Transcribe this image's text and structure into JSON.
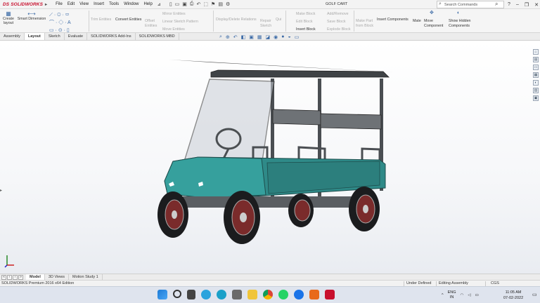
{
  "app": {
    "logo_ds": "DS",
    "logo_text": "SOLIDWORKS",
    "document_title": "GOLF CART",
    "menu": [
      "File",
      "Edit",
      "View",
      "Insert",
      "Tools",
      "Window",
      "Help"
    ],
    "search_placeholder": "Search Commands"
  },
  "commands": {
    "create_layout": "Create layout",
    "smart_dimension": "Smart Dimension",
    "trim_entities": "Trim Entities",
    "convert_entities": "Convert Entities",
    "offset_entities": "Offset Entities",
    "mirror_entities": "Mirror Entities",
    "linear_sketch_pattern": "Linear Sketch Pattern",
    "move_entities": "Move Entities",
    "display_delete_relations": "Display/Delete Relations",
    "repair_sketch": "Repair Sketch",
    "quick": "Qui",
    "make_block": "Make Block",
    "edit_block": "Edit Block",
    "insert_block": "Insert Block",
    "add_remove": "Add/Remove",
    "save_block": "Save Block",
    "explode_block": "Explode Block",
    "make_part_from_block": "Make Part from Block",
    "insert_components": "Insert Components",
    "mate": "Mate",
    "move_component": "Move Component",
    "show_hidden_components": "Show Hidden Components"
  },
  "tabs": [
    "Assembly",
    "Layout",
    "Sketch",
    "Evaluate",
    "SOLIDWORKS Add-Ins",
    "SOLIDWORKS MBD"
  ],
  "active_tab": "Layout",
  "model_tabs": [
    "Model",
    "3D Views",
    "Motion Study 1"
  ],
  "active_model_tab": "Model",
  "status": {
    "product": "SOLIDWORKS Premium 2016 x64 Edition",
    "definition": "Under Defined",
    "mode": "Editing Assembly",
    "units": "CGS"
  },
  "taskbar": {
    "language_line1": "ENG",
    "language_line2": "IN",
    "time": "11:05 AM",
    "date": "07-02-2022"
  },
  "colors": {
    "body_teal": "#2f8a88",
    "logo_red": "#c8102e",
    "roof": "#3f4346"
  }
}
